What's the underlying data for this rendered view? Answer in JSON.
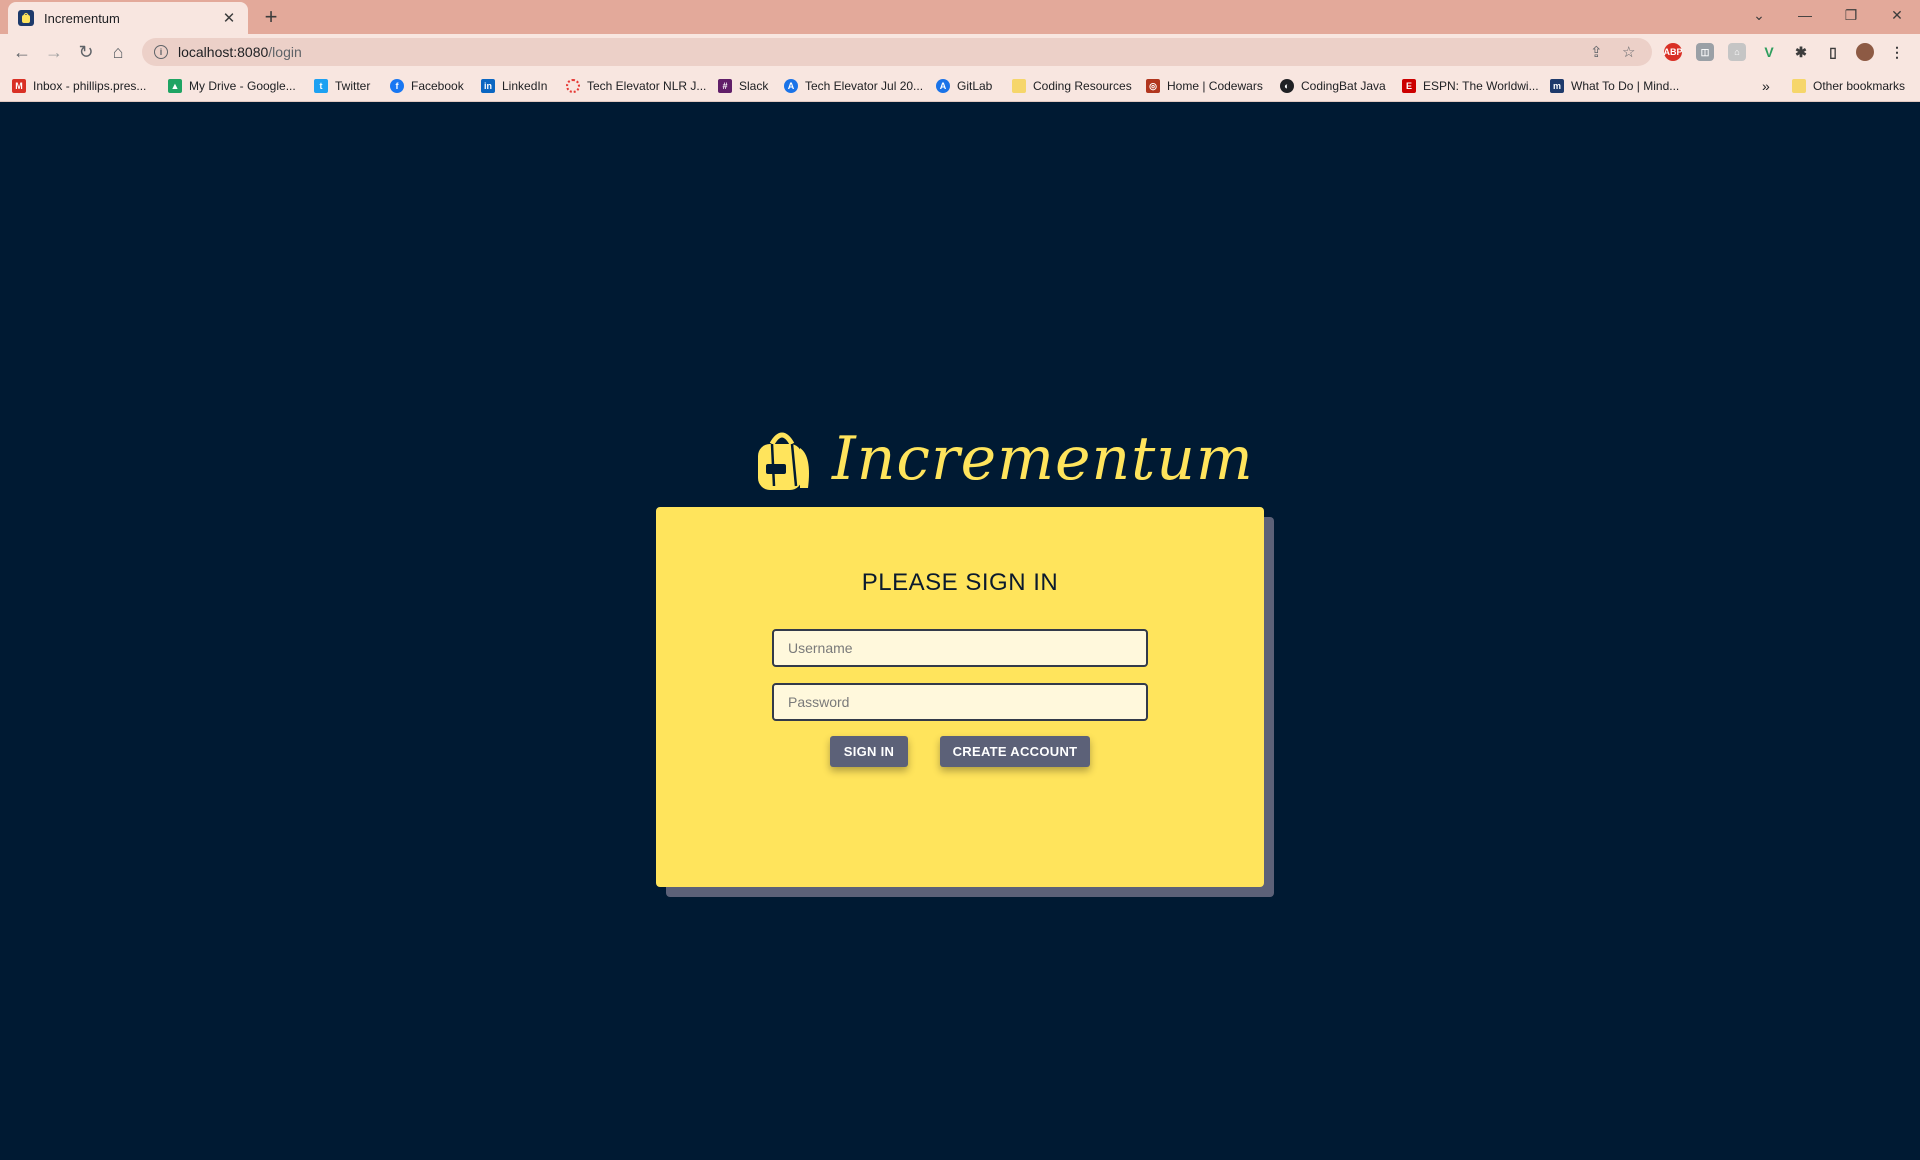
{
  "browser": {
    "tab_title": "Incrementum",
    "url_host": "localhost:8080",
    "url_path": "/login",
    "bookmarks": [
      {
        "label": "Inbox - phillips.pres...",
        "icon": "gmail-icon",
        "color": "#d93025"
      },
      {
        "label": "My Drive - Google...",
        "icon": "drive-icon",
        "color": "#1fa463"
      },
      {
        "label": "Twitter",
        "icon": "twitter-icon",
        "color": "#1da1f2"
      },
      {
        "label": "Facebook",
        "icon": "facebook-icon",
        "color": "#1877f2"
      },
      {
        "label": "LinkedIn",
        "icon": "linkedin-icon",
        "color": "#0a66c2"
      },
      {
        "label": "Tech Elevator NLR J...",
        "icon": "tech-elevator-icon",
        "color": "#e53935"
      },
      {
        "label": "Slack",
        "icon": "slack-icon",
        "color": "#611f69"
      },
      {
        "label": "Tech Elevator Jul 20...",
        "icon": "compass-icon",
        "color": "#1a73e8"
      },
      {
        "label": "GitLab",
        "icon": "gitlab-icon",
        "color": "#1a73e8"
      },
      {
        "label": "Coding Resources",
        "icon": "folder-icon",
        "color": "#f6d66a"
      },
      {
        "label": "Home | Codewars",
        "icon": "codewars-icon",
        "color": "#b1361e"
      },
      {
        "label": "CodingBat Java",
        "icon": "globe-icon",
        "color": "#202124"
      },
      {
        "label": "ESPN: The Worldwi...",
        "icon": "espn-icon",
        "color": "#cc0000"
      },
      {
        "label": "What To Do | Mind...",
        "icon": "mind-icon",
        "color": "#1e3a6b"
      }
    ],
    "overflow": "»",
    "other_bookmarks": "Other bookmarks"
  },
  "page": {
    "brand": "Incrementum",
    "heading": "PLEASE SIGN IN",
    "username_placeholder": "Username",
    "password_placeholder": "Password",
    "sign_in": "SIGN IN",
    "create_account": "CREATE ACCOUNT"
  },
  "colors": {
    "background": "#001a33",
    "card": "#ffe45c",
    "button": "#5c6178",
    "brand_text": "#ffe45c"
  }
}
